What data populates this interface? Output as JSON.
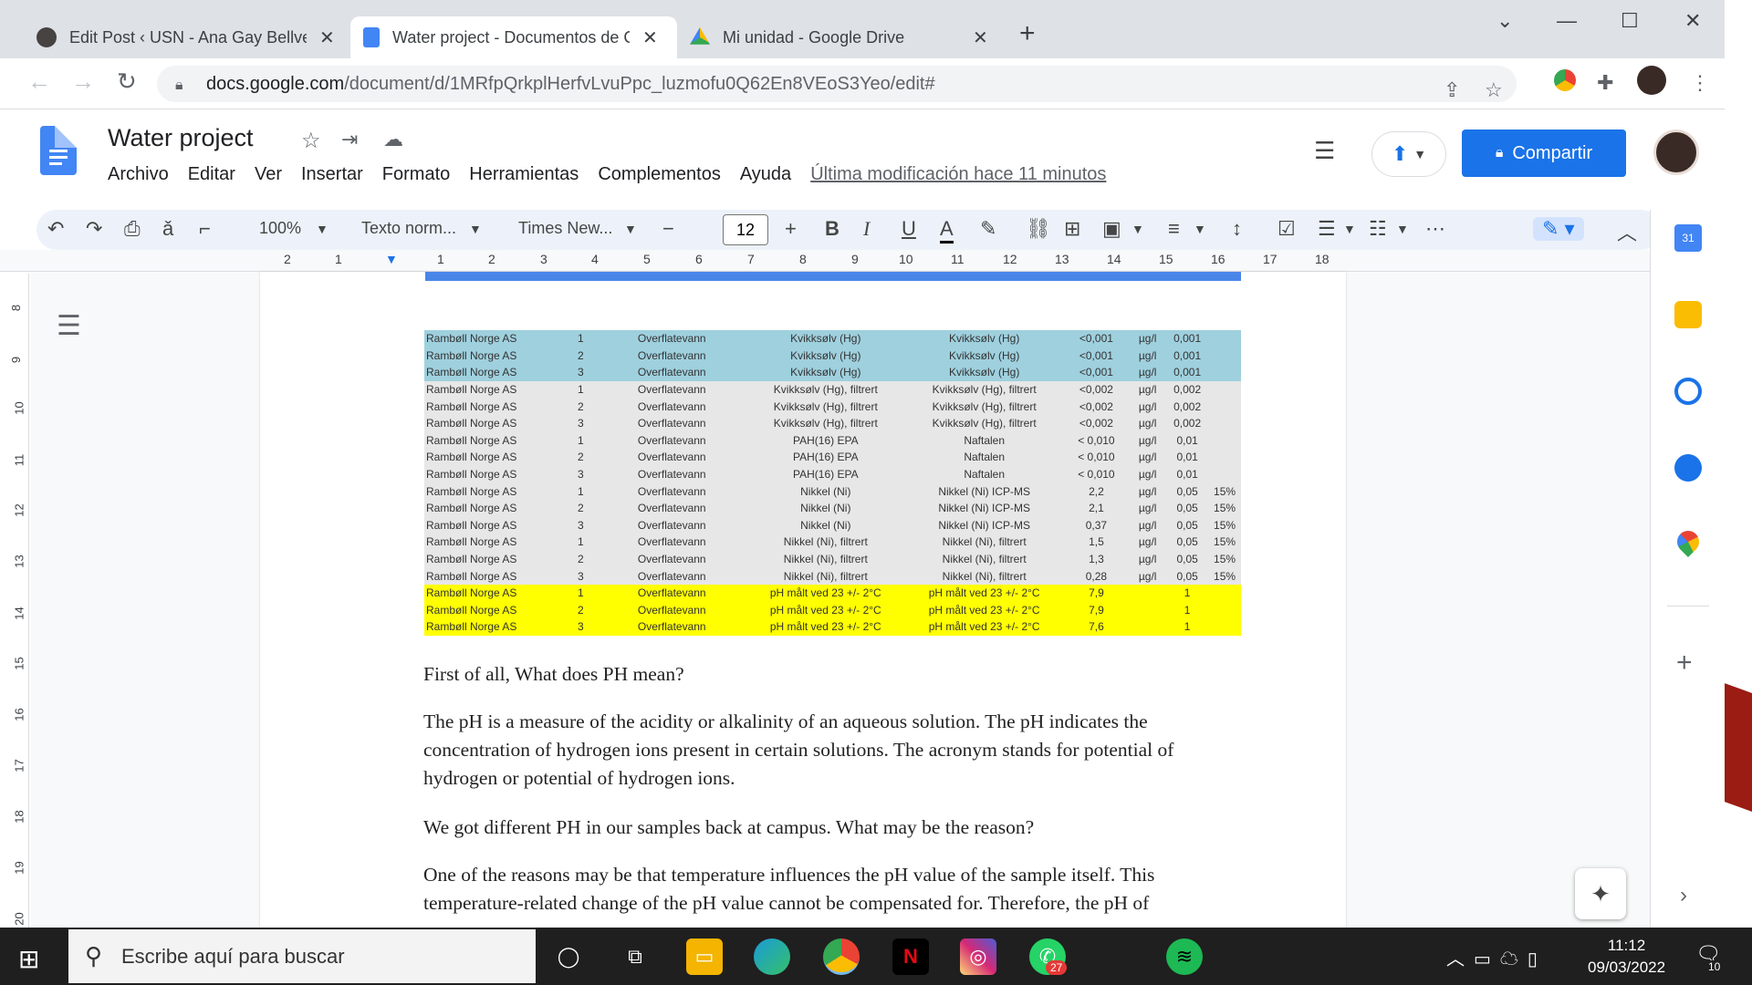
{
  "browser": {
    "tabs": [
      {
        "title": "Edit Post ‹ USN - Ana Gay Bellver",
        "icon": "wordpress-icon",
        "active": false
      },
      {
        "title": "Water project - Documentos de Google",
        "icon": "google-docs-icon",
        "active": true
      },
      {
        "title": "Mi unidad - Google Drive",
        "icon": "google-drive-icon",
        "active": false
      }
    ],
    "url_host": "docs.google.com",
    "url_path": "/document/d/1MRfpQrkplHerfvLvuPpc_luzmofu0Q62En8VEoS3Yeo/edit#"
  },
  "doc": {
    "title": "Water project",
    "menu": [
      "Archivo",
      "Editar",
      "Ver",
      "Insertar",
      "Formato",
      "Herramientas",
      "Complementos",
      "Ayuda"
    ],
    "last_modified": "Última modificación hace 11 minutos",
    "share_label": "Compartir"
  },
  "toolbar": {
    "zoom": "100%",
    "style": "Texto norm...",
    "font": "Times New...",
    "font_size": "12"
  },
  "ruler": {
    "h_ticks": [
      "2",
      "1",
      "1",
      "2",
      "3",
      "4",
      "5",
      "6",
      "7",
      "8",
      "9",
      "10",
      "11",
      "12",
      "13",
      "14",
      "15",
      "16",
      "17",
      "18"
    ],
    "v_ticks": [
      "8",
      "9",
      "10",
      "11",
      "12",
      "13",
      "14",
      "15",
      "16",
      "17",
      "18",
      "19",
      "20"
    ]
  },
  "table": {
    "rows": [
      {
        "style": "blue",
        "cells": [
          "Rambøll Norge AS",
          "1",
          "Overflatevann",
          "Kvikksølv (Hg)",
          "Kvikksølv (Hg)",
          "<0,001",
          "µg/l",
          "0,001",
          ""
        ]
      },
      {
        "style": "blue",
        "cells": [
          "Rambøll Norge AS",
          "2",
          "Overflatevann",
          "Kvikksølv (Hg)",
          "Kvikksølv (Hg)",
          "<0,001",
          "µg/l",
          "0,001",
          ""
        ]
      },
      {
        "style": "blue",
        "cells": [
          "Rambøll Norge AS",
          "3",
          "Overflatevann",
          "Kvikksølv (Hg)",
          "Kvikksølv (Hg)",
          "<0,001",
          "µg/l",
          "0,001",
          ""
        ]
      },
      {
        "style": "grey",
        "cells": [
          "Rambøll Norge AS",
          "1",
          "Overflatevann",
          "Kvikksølv (Hg), filtrert",
          "Kvikksølv (Hg), filtrert",
          "<0,002",
          "µg/l",
          "0,002",
          ""
        ]
      },
      {
        "style": "grey",
        "cells": [
          "Rambøll Norge AS",
          "2",
          "Overflatevann",
          "Kvikksølv (Hg), filtrert",
          "Kvikksølv (Hg), filtrert",
          "<0,002",
          "µg/l",
          "0,002",
          ""
        ]
      },
      {
        "style": "grey",
        "cells": [
          "Rambøll Norge AS",
          "3",
          "Overflatevann",
          "Kvikksølv (Hg), filtrert",
          "Kvikksølv (Hg), filtrert",
          "<0,002",
          "µg/l",
          "0,002",
          ""
        ]
      },
      {
        "style": "grey",
        "cells": [
          "Rambøll Norge AS",
          "1",
          "Overflatevann",
          "PAH(16) EPA",
          "Naftalen",
          "< 0,010",
          "µg/l",
          "0,01",
          ""
        ]
      },
      {
        "style": "grey",
        "cells": [
          "Rambøll Norge AS",
          "2",
          "Overflatevann",
          "PAH(16) EPA",
          "Naftalen",
          "< 0,010",
          "µg/l",
          "0,01",
          ""
        ]
      },
      {
        "style": "grey",
        "cells": [
          "Rambøll Norge AS",
          "3",
          "Overflatevann",
          "PAH(16) EPA",
          "Naftalen",
          "< 0,010",
          "µg/l",
          "0,01",
          ""
        ]
      },
      {
        "style": "grey",
        "cells": [
          "Rambøll Norge AS",
          "1",
          "Overflatevann",
          "Nikkel (Ni)",
          "Nikkel (Ni) ICP-MS",
          "2,2",
          "µg/l",
          "0,05",
          "15%"
        ]
      },
      {
        "style": "grey",
        "cells": [
          "Rambøll Norge AS",
          "2",
          "Overflatevann",
          "Nikkel (Ni)",
          "Nikkel (Ni) ICP-MS",
          "2,1",
          "µg/l",
          "0,05",
          "15%"
        ]
      },
      {
        "style": "grey",
        "cells": [
          "Rambøll Norge AS",
          "3",
          "Overflatevann",
          "Nikkel (Ni)",
          "Nikkel (Ni) ICP-MS",
          "0,37",
          "µg/l",
          "0,05",
          "15%"
        ]
      },
      {
        "style": "grey",
        "cells": [
          "Rambøll Norge AS",
          "1",
          "Overflatevann",
          "Nikkel (Ni), filtrert",
          "Nikkel (Ni), filtrert",
          "1,5",
          "µg/l",
          "0,05",
          "15%"
        ]
      },
      {
        "style": "grey",
        "cells": [
          "Rambøll Norge AS",
          "2",
          "Overflatevann",
          "Nikkel (Ni), filtrert",
          "Nikkel (Ni), filtrert",
          "1,3",
          "µg/l",
          "0,05",
          "15%"
        ]
      },
      {
        "style": "grey",
        "cells": [
          "Rambøll Norge AS",
          "3",
          "Overflatevann",
          "Nikkel (Ni), filtrert",
          "Nikkel (Ni), filtrert",
          "0,28",
          "µg/l",
          "0,05",
          "15%"
        ]
      },
      {
        "style": "yellow",
        "cells": [
          "Rambøll Norge AS",
          "1",
          "Overflatevann",
          "pH målt ved 23 +/- 2°C",
          "pH målt ved 23 +/- 2°C",
          "7,9",
          "",
          "1",
          ""
        ]
      },
      {
        "style": "yellow",
        "cells": [
          "Rambøll Norge AS",
          "2",
          "Overflatevann",
          "pH målt ved 23 +/- 2°C",
          "pH målt ved 23 +/- 2°C",
          "7,9",
          "",
          "1",
          ""
        ]
      },
      {
        "style": "yellow",
        "cells": [
          "Rambøll Norge AS",
          "3",
          "Overflatevann",
          "pH målt ved 23 +/- 2°C",
          "pH målt ved 23 +/- 2°C",
          "7,6",
          "",
          "1",
          ""
        ]
      }
    ]
  },
  "paragraphs": [
    "First of all, What does PH mean?",
    "The pH is a measure of the acidity or alkalinity of an aqueous solution. The pH indicates the concentration of hydrogen ions present in certain solutions. The acronym stands for potential of hydrogen or potential of hydrogen ions.",
    "We got different PH in our samples back at campus. What may be the reason?",
    "One of the reasons may be that temperature influences the pH value of the sample itself. This temperature-related change of the pH value cannot be compensated for. Therefore, the pH of"
  ],
  "taskbar": {
    "search_placeholder": "Escribe aquí para buscar",
    "whatsapp_badge": "27",
    "time": "11:12",
    "date": "09/03/2022",
    "notifications": "10"
  },
  "colors": {
    "accent": "#1a73e8",
    "table_blue": "#9fd0de",
    "table_grey": "#e7e7e7",
    "table_yellow": "#ffff00"
  }
}
